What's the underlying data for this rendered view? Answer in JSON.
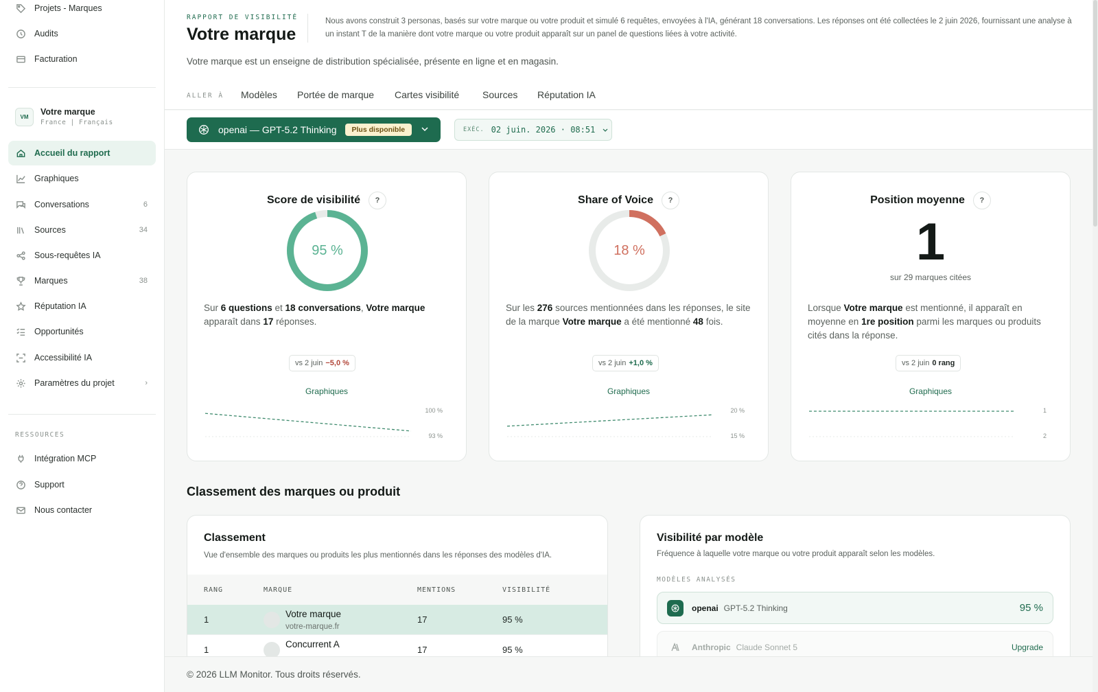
{
  "sidebar": {
    "top_items": [
      {
        "label": "Projets - Marques",
        "icon": "tag-icon"
      },
      {
        "label": "Audits",
        "icon": "history-icon"
      },
      {
        "label": "Facturation",
        "icon": "credit-card-icon"
      }
    ],
    "brand": {
      "initials": "VM",
      "name": "Votre marque",
      "subtitle": "France | Français"
    },
    "items": [
      {
        "label": "Accueil du rapport",
        "icon": "home-icon",
        "count": "",
        "active": true
      },
      {
        "label": "Graphiques",
        "icon": "line-chart-icon",
        "count": ""
      },
      {
        "label": "Conversations",
        "icon": "chat-icon",
        "count": "6"
      },
      {
        "label": "Sources",
        "icon": "library-icon",
        "count": "34"
      },
      {
        "label": "Sous-requêtes IA",
        "icon": "share-nodes-icon",
        "count": ""
      },
      {
        "label": "Marques",
        "icon": "trophy-icon",
        "count": "38"
      },
      {
        "label": "Réputation IA",
        "icon": "star-icon",
        "count": ""
      },
      {
        "label": "Opportunités",
        "icon": "list-check-icon",
        "count": ""
      },
      {
        "label": "Accessibilité IA",
        "icon": "scan-icon",
        "count": ""
      },
      {
        "label": "Paramètres du projet",
        "icon": "gear-icon",
        "count": ""
      }
    ],
    "resources_label": "RESSOURCES",
    "resources": [
      {
        "label": "Intégration MCP",
        "icon": "plug-icon"
      },
      {
        "label": "Support",
        "icon": "help-circle-icon"
      },
      {
        "label": "Nous contacter",
        "icon": "mail-icon"
      }
    ]
  },
  "header": {
    "report_label": "RAPPORT DE VISIBILITÉ",
    "title": "Votre marque",
    "intro": "Nous avons construit 3 personas, basés sur votre marque ou votre produit et simulé 6 requêtes, envoyées à l'IA, générant 18 conversations. Les réponses ont été collectées le 2 juin 2026, fournissant une analyse à un instant T de la manière dont votre marque ou votre produit apparaît sur un panel de questions liées à votre activité.",
    "description": "Votre marque est un enseigne de distribution spécialisée, présente en ligne et en magasin.",
    "goto_label": "ALLER À",
    "goto_links": [
      "Modèles",
      "Portée de marque",
      "Cartes visibilité",
      "Sources",
      "Réputation IA"
    ]
  },
  "toolbar": {
    "model": "openai — GPT-5.2 Thinking",
    "model_badge": "Plus disponible",
    "exec_label": "EXÉC.",
    "exec_value": "02 juin. 2026 · 08:51"
  },
  "kpis": {
    "visibility": {
      "title": "Score de visibilité",
      "value": 95,
      "value_label": "95 %",
      "text_parts": [
        "Sur ",
        "6 questions",
        " et ",
        "18 conversations",
        ", ",
        "Votre marque",
        " apparaît dans ",
        "17",
        " réponses."
      ],
      "delta_prefix": "vs 2 juin",
      "delta_value": "−5,0 %",
      "link": "Graphiques",
      "spark_max_label": "100 %",
      "spark_min_label": "93 %",
      "spark": [
        99,
        94
      ]
    },
    "sov": {
      "title": "Share of Voice",
      "value": 18,
      "value_label": "18 %",
      "text_parts": [
        "Sur les ",
        "276",
        " sources mentionnées dans les réponses, le site de la marque ",
        "Votre marque",
        " a été mentionné ",
        "48",
        " fois."
      ],
      "delta_prefix": "vs 2 juin",
      "delta_value": "+1,0 %",
      "link": "Graphiques",
      "spark_max_label": "20 %",
      "spark_min_label": "15 %",
      "spark": [
        16.7,
        19
      ]
    },
    "position": {
      "title": "Position moyenne",
      "value_label": "1",
      "subtitle": "sur 29 marques citées",
      "text_parts": [
        "Lorsque ",
        "Votre marque",
        " est mentionné, il apparaît en moyenne en ",
        "1re position",
        " parmi les marques ou produits cités dans la réponse."
      ],
      "delta_prefix": "vs 2 juin",
      "delta_value": "0 rang",
      "link": "Graphiques",
      "spark_max_label": "1",
      "spark_min_label": "2",
      "spark": [
        1,
        1
      ]
    }
  },
  "ranking": {
    "section_title": "Classement des marques ou produit",
    "card_title": "Classement",
    "card_subtitle": "Vue d'ensemble des marques ou produits les plus mentionnés dans les réponses des modèles d'IA.",
    "columns": [
      "RANG",
      "MARQUE",
      "MENTIONS",
      "VISIBILITÉ"
    ],
    "rows": [
      {
        "rank": "1",
        "name": "Votre marque",
        "domain": "votre-marque.fr",
        "mentions": "17",
        "visibility": "95 %"
      },
      {
        "rank": "1",
        "name": "Concurrent A",
        "domain": "",
        "mentions": "17",
        "visibility": "95 %"
      }
    ]
  },
  "models": {
    "title": "Visibilité par modèle",
    "subtitle": "Fréquence à laquelle votre marque ou votre produit apparaît selon les modèles.",
    "label": "MODÈLES ANALYSÉS",
    "items": [
      {
        "provider": "openai",
        "model": "GPT-5.2 Thinking",
        "value": "95  %"
      },
      {
        "provider": "Anthropic",
        "model": "Claude Sonnet 5",
        "action": "Upgrade"
      }
    ]
  },
  "footer": {
    "text": "© 2026 LLM Monitor. Tous droits réservés."
  },
  "colors": {
    "accent": "#1e6b4f",
    "positive": "#5bb393",
    "negative_accent": "#d0705f",
    "delta_negative": "#b2473a",
    "delta_positive": "#1f6b4e"
  }
}
